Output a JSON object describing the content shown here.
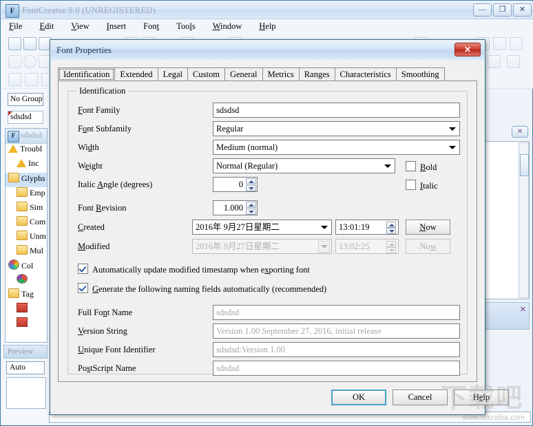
{
  "app": {
    "title": "FontCreator 9.0 (UNREGISTERED)",
    "icon": "F",
    "window_buttons": {
      "minimize": "—",
      "maximize": "❐",
      "close": "✕"
    },
    "menu": [
      {
        "label": "File",
        "accel": "F"
      },
      {
        "label": "Edit",
        "accel": "E"
      },
      {
        "label": "View",
        "accel": "V"
      },
      {
        "label": "Insert",
        "accel": "I"
      },
      {
        "label": "Font",
        "accel": "t"
      },
      {
        "label": "Tools",
        "accel": "l"
      },
      {
        "label": "Window",
        "accel": "W"
      },
      {
        "label": "Help",
        "accel": "H"
      }
    ],
    "left_panel": {
      "grouping_combo": "No Grouping",
      "document_tab": "sdsdsd",
      "tree_title": "sdsdsd",
      "tree_items": [
        {
          "label": "Troubl",
          "icon": "warning-icon",
          "indent": 0,
          "selected": false
        },
        {
          "label": "Inc",
          "icon": "warning-icon",
          "indent": 1,
          "selected": false
        },
        {
          "label": "Glyphs",
          "icon": "folder-icon",
          "indent": 0,
          "selected": true
        },
        {
          "label": "Emp",
          "icon": "folder-icon",
          "indent": 1,
          "selected": false
        },
        {
          "label": "Sim",
          "icon": "folder-icon",
          "indent": 1,
          "selected": false
        },
        {
          "label": "Com",
          "icon": "folder-icon",
          "indent": 1,
          "selected": false
        },
        {
          "label": "Unm",
          "icon": "folder-icon",
          "indent": 1,
          "selected": false
        },
        {
          "label": "Mul",
          "icon": "folder-icon",
          "indent": 1,
          "selected": false
        },
        {
          "label": "Col",
          "icon": "color-wheel-icon",
          "indent": 0,
          "selected": false
        },
        {
          "label": "",
          "icon": "pie-icon",
          "indent": 1,
          "selected": false
        },
        {
          "label": "Tag",
          "icon": "folder-icon",
          "indent": 0,
          "selected": false
        },
        {
          "label": "",
          "icon": "flag-icon",
          "indent": 1,
          "selected": false
        },
        {
          "label": "",
          "icon": "flag-icon",
          "indent": 1,
          "selected": false
        }
      ],
      "preview_title": "Preview",
      "preview_combo": "Auto"
    },
    "right_panel": {
      "close_label": "✕",
      "panel2_close_label": "✕"
    }
  },
  "dialog": {
    "title": "Font Properties",
    "close_label": "✕",
    "tabs": [
      {
        "label": "Identification",
        "active": true
      },
      {
        "label": "Extended",
        "active": false
      },
      {
        "label": "Legal",
        "active": false
      },
      {
        "label": "Custom",
        "active": false
      },
      {
        "label": "General",
        "active": false
      },
      {
        "label": "Metrics",
        "active": false
      },
      {
        "label": "Ranges",
        "active": false
      },
      {
        "label": "Characteristics",
        "active": false
      },
      {
        "label": "Smoothing",
        "active": false
      }
    ],
    "group_legend": "Identification",
    "fields": {
      "font_family": {
        "label": "Font Family",
        "accel": "F",
        "rest": "ont Family",
        "value": "sdsdsd"
      },
      "font_subfamily": {
        "label": "Font Subfamily",
        "pre": "F",
        "accel": "o",
        "rest": "nt Subfamily",
        "value": "Regular"
      },
      "width": {
        "label": "Width",
        "pre": "Wi",
        "accel": "d",
        "rest": "th",
        "value": "Medium (normal)"
      },
      "weight": {
        "label": "Weight",
        "pre": "W",
        "accel": "e",
        "rest": "ight",
        "value": "Normal (Regular)"
      },
      "bold": {
        "label": "Bold",
        "accel": "B",
        "rest": "old",
        "checked": false
      },
      "italic_angle": {
        "label": "Italic Angle (degrees)",
        "pre": "Italic ",
        "accel": "A",
        "rest": "ngle (degrees)",
        "value": "0"
      },
      "italic": {
        "label": "Italic",
        "accel": "I",
        "rest": "talic",
        "checked": false
      },
      "font_revision": {
        "label": "Font Revision",
        "pre": "Font ",
        "accel": "R",
        "rest": "evision",
        "value": "1.000"
      },
      "created": {
        "label": "Created",
        "accel": "C",
        "rest": "reated",
        "date": "2016年 9月27日星期二",
        "time": "13:01:19",
        "now_label": "Now",
        "now_accel": "N",
        "now_rest": "ow",
        "disabled": false
      },
      "modified": {
        "label": "Modified",
        "accel": "M",
        "rest": "odified",
        "date": "2016年 9月27日星期二",
        "time": "13:02:25",
        "now_label": "Now",
        "now_accel": "w",
        "disabled": true
      },
      "auto_update": {
        "label": "Automatically update modified timestamp when exporting font",
        "pre": "Automatically update modified timestamp when e",
        "accel": "x",
        "rest": "porting font",
        "checked": true
      },
      "generate_auto": {
        "label": "Generate the following naming fields automatically (recommended)",
        "accel": "G",
        "rest": "enerate the following naming fields automatically (recommended)",
        "checked": true
      },
      "full_font_name": {
        "label": "Full Font Name",
        "pre": "Full Fo",
        "accel": "n",
        "rest": "t Name",
        "value": "sdsdsd",
        "readonly": true
      },
      "version_string": {
        "label": "Version String",
        "accel": "V",
        "rest": "ersion String",
        "value": "Version 1.00 September 27, 2016, initial release",
        "readonly": true
      },
      "unique_font_identifier": {
        "label": "Unique Font Identifier",
        "accel": "U",
        "rest": "nique Font Identifier",
        "value": "sdsdsd:Version 1.00",
        "readonly": true
      },
      "postscript_name": {
        "label": "PostScript Name",
        "pre": "Po",
        "accel": "s",
        "rest": "tScript Name",
        "value": "sdsdsd",
        "readonly": true
      }
    },
    "buttons": {
      "ok": "OK",
      "cancel": "Cancel",
      "help_pre": "H",
      "help_accel": "e",
      "help_rest": "lp",
      "help": "Help"
    }
  },
  "watermark": {
    "logo": "下载吧",
    "url": "www.xiazaiba.com"
  }
}
